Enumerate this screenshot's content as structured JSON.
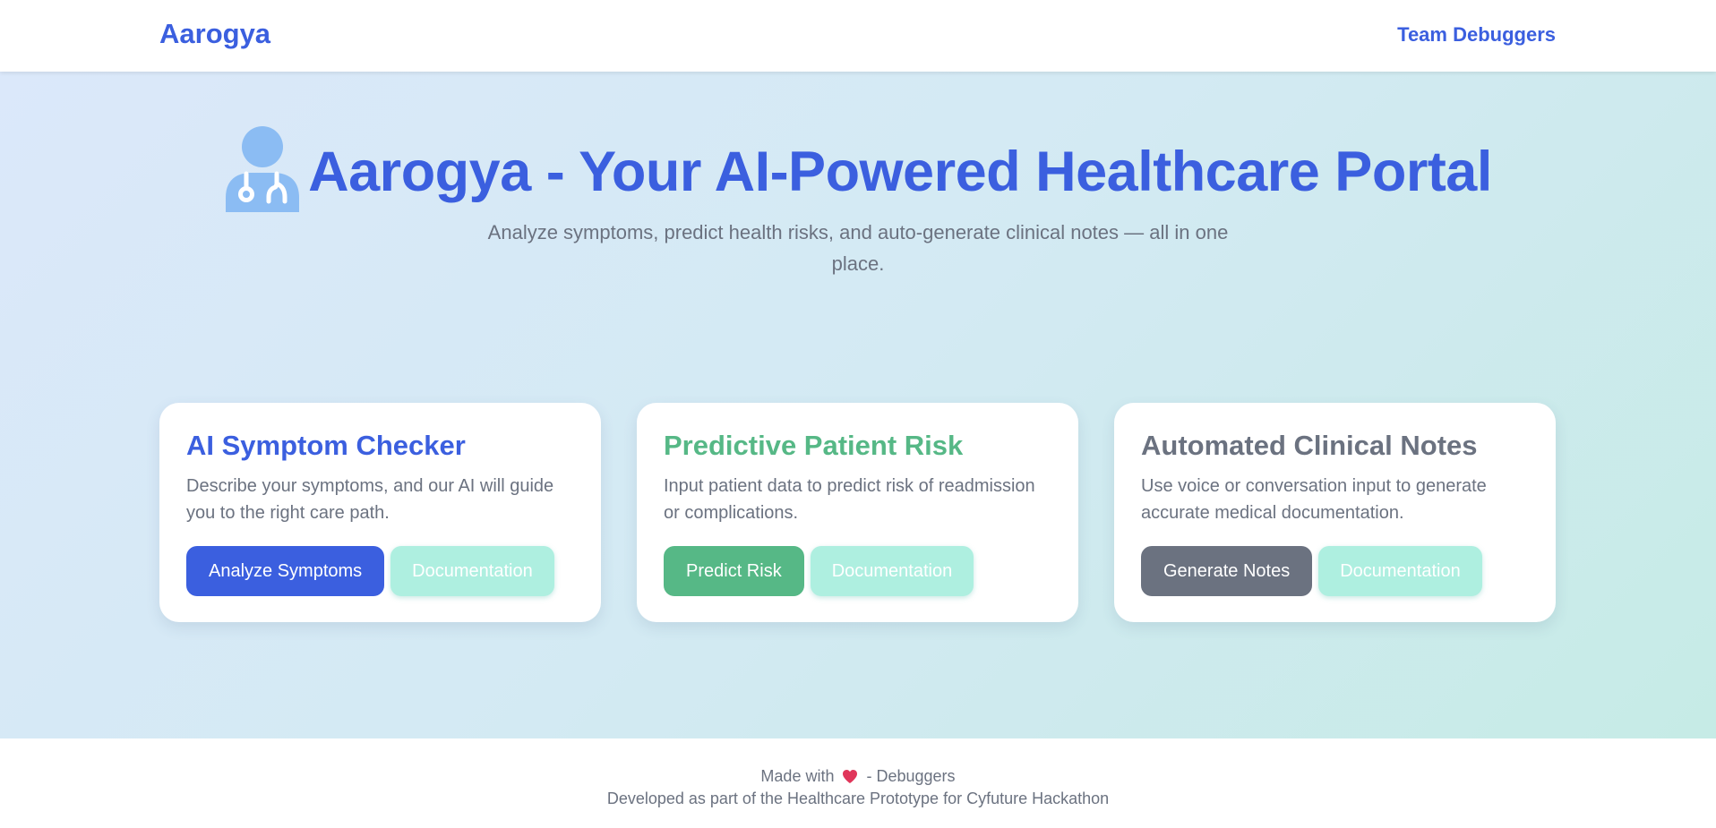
{
  "navbar": {
    "brand": "Aarogya",
    "team_link": "Team Debuggers"
  },
  "hero": {
    "icon": "doctor-icon",
    "title": "Aarogya - Your AI-Powered Healthcare Portal",
    "subtitle": "Analyze symptoms, predict health risks, and auto-generate clinical notes — all in one place."
  },
  "cards": [
    {
      "title": "AI Symptom Checker",
      "description": "Describe your symptoms, and our AI will guide you to the right care path.",
      "primary_button": "Analyze Symptoms",
      "secondary_button": "Documentation",
      "accent_color": "#3b5fdf"
    },
    {
      "title": "Predictive Patient Risk",
      "description": "Input patient data to predict risk of readmission or complications.",
      "primary_button": "Predict Risk",
      "secondary_button": "Documentation",
      "accent_color": "#56b886"
    },
    {
      "title": "Automated Clinical Notes",
      "description": "Use voice or conversation input to generate accurate medical documentation.",
      "primary_button": "Generate Notes",
      "secondary_button": "Documentation",
      "accent_color": "#6b7280"
    }
  ],
  "footer": {
    "made_with": "Made with",
    "heart_icon": "heart-icon",
    "made_by": "- Debuggers",
    "developed": "Developed as part of the Healthcare Prototype for Cyfuture Hackathon"
  },
  "colors": {
    "primary": "#3b5fdf",
    "success": "#56b886",
    "muted": "#6b7280",
    "doc_button": "#aeefe0",
    "heart": "#e0365a"
  }
}
